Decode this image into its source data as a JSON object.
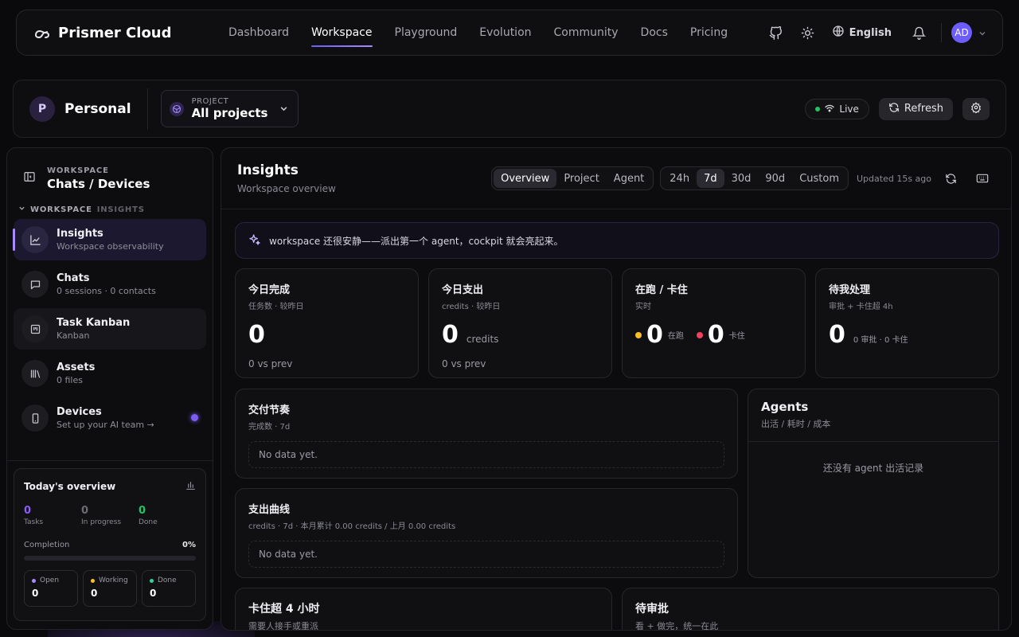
{
  "brand": {
    "name": "Prismer Cloud"
  },
  "nav": {
    "links": [
      "Dashboard",
      "Workspace",
      "Playground",
      "Evolution",
      "Community",
      "Docs",
      "Pricing"
    ],
    "language": "English",
    "avatar_initials": "AD"
  },
  "context": {
    "workspace_initial": "P",
    "workspace_name": "Personal",
    "project_label": "PROJECT",
    "project_value": "All projects",
    "live_label": "Live",
    "refresh_label": "Refresh"
  },
  "sidebar": {
    "header_label": "WORKSPACE",
    "header_title": "Chats / Devices",
    "section_a": "WORKSPACE",
    "section_b": "INSIGHTS",
    "items": [
      {
        "title": "Insights",
        "sub": "Workspace observability",
        "icon": "chart-line-icon"
      },
      {
        "title": "Chats",
        "sub": "0 sessions · 0 contacts",
        "icon": "chat-bubble-icon"
      },
      {
        "title": "Task Kanban",
        "sub": "Kanban",
        "icon": "kanban-icon"
      },
      {
        "title": "Assets",
        "sub": "0 files",
        "icon": "library-icon"
      },
      {
        "title": "Devices",
        "sub": "Set up your AI team →",
        "icon": "device-icon"
      }
    ]
  },
  "overview": {
    "title": "Today's overview",
    "stats": [
      {
        "value": "0",
        "label": "Tasks",
        "color": "#8b5cf6"
      },
      {
        "value": "0",
        "label": "In progress",
        "color": "#6b6b74"
      },
      {
        "value": "0",
        "label": "Done",
        "color": "#22c55e"
      }
    ],
    "completion_label": "Completion",
    "completion_value": "0%",
    "completion_fraction": 0,
    "boxes": [
      {
        "label": "Open",
        "value": "0",
        "color": "#a78bfa"
      },
      {
        "label": "Working",
        "value": "0",
        "color": "#fbbf24"
      },
      {
        "label": "Done",
        "value": "0",
        "color": "#34d399"
      }
    ]
  },
  "main": {
    "title": "Insights",
    "subtitle": "Workspace overview",
    "scope_tabs": [
      "Overview",
      "Project",
      "Agent"
    ],
    "range_tabs": [
      "24h",
      "7d",
      "30d",
      "90d",
      "Custom"
    ],
    "updated": "Updated 15s ago",
    "banner": "workspace 还很安静——派出第一个 agent，cockpit 就会亮起来。",
    "cards": {
      "done_today": {
        "title": "今日完成",
        "sub": "任务数 · 较昨日",
        "value": "0",
        "foot": "0 vs prev"
      },
      "spend_today": {
        "title": "今日支出",
        "sub": "credits · 较昨日",
        "value": "0",
        "unit": "credits",
        "foot": "0 vs prev"
      },
      "running": {
        "title": "在跑 / 卡住",
        "sub": "实时",
        "running_value": "0",
        "running_label": "在跑",
        "stuck_value": "0",
        "stuck_label": "卡住"
      },
      "pending": {
        "title": "待我处理",
        "sub": "审批 + 卡住超 4h",
        "value": "0",
        "detail": "0 审批 · 0 卡住"
      },
      "delivery": {
        "title": "交付节奏",
        "sub": "完成数 · 7d",
        "empty": "No data yet."
      },
      "spend_curve": {
        "title": "支出曲线",
        "sub": "credits · 7d · 本月累计 0.00 credits / 上月 0.00 credits",
        "empty": "No data yet."
      },
      "agents": {
        "title": "Agents",
        "sub": "出活 / 耗时 / 成本",
        "empty": "还没有 agent 出活记录"
      },
      "stuck": {
        "title": "卡住超 4 小时",
        "sub": "需要人接手或重派"
      },
      "approvals": {
        "title": "待审批",
        "sub": "看 + 做完，统一在此"
      }
    }
  },
  "colors": {
    "accent": "#7c5cf4",
    "running": "#fbbf24",
    "stuck": "#f43f5e",
    "live": "#22c55e"
  }
}
